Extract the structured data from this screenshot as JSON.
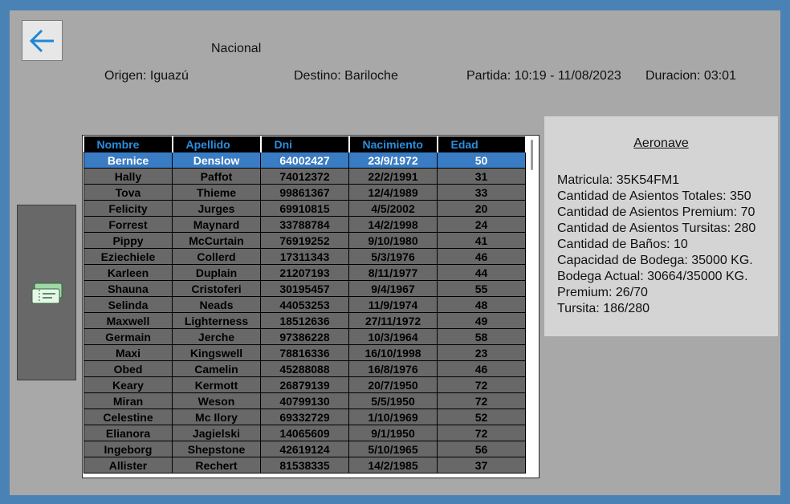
{
  "header": {
    "type": "Nacional",
    "origin": "Origen: Iguazú",
    "destination": "Destino: Bariloche",
    "departure": "Partida: 10:19 - 11/08/2023",
    "duration": "Duracion: 03:01"
  },
  "colors": {
    "accent": "#2a8ee0",
    "selected_row": "#3a7cc4",
    "row_bg": "#686868",
    "frame": "#4a82b5"
  },
  "icons": {
    "back": "arrow-left-icon",
    "tickets": "ticket-icon"
  },
  "table": {
    "columns": [
      "Nombre",
      "Apellido",
      "Dni",
      "Nacimiento",
      "Edad"
    ],
    "selected_index": 0,
    "rows": [
      [
        "Bernice",
        "Denslow",
        "64002427",
        "23/9/1972",
        "50"
      ],
      [
        "Hally",
        "Paffot",
        "74012372",
        "22/2/1991",
        "31"
      ],
      [
        "Tova",
        "Thieme",
        "99861367",
        "12/4/1989",
        "33"
      ],
      [
        "Felicity",
        "Jurges",
        "69910815",
        "4/5/2002",
        "20"
      ],
      [
        "Forrest",
        "Maynard",
        "33788784",
        "14/2/1998",
        "24"
      ],
      [
        "Pippy",
        "McCurtain",
        "76919252",
        "9/10/1980",
        "41"
      ],
      [
        "Eziechiele",
        "Collerd",
        "17311343",
        "5/3/1976",
        "46"
      ],
      [
        "Karleen",
        "Duplain",
        "21207193",
        "8/11/1977",
        "44"
      ],
      [
        "Shauna",
        "Cristoferi",
        "30195457",
        "9/4/1967",
        "55"
      ],
      [
        "Selinda",
        "Neads",
        "44053253",
        "11/9/1974",
        "48"
      ],
      [
        "Maxwell",
        "Lighterness",
        "18512636",
        "27/11/1972",
        "49"
      ],
      [
        "Germain",
        "Jerche",
        "97386228",
        "10/3/1964",
        "58"
      ],
      [
        "Maxi",
        "Kingswell",
        "78816336",
        "16/10/1998",
        "23"
      ],
      [
        "Obed",
        "Camelin",
        "45288088",
        "16/8/1976",
        "46"
      ],
      [
        "Keary",
        "Kermott",
        "26879139",
        "20/7/1950",
        "72"
      ],
      [
        "Miran",
        "Weson",
        "40799130",
        "5/5/1950",
        "72"
      ],
      [
        "Celestine",
        "Mc Ilory",
        "69332729",
        "1/10/1969",
        "52"
      ],
      [
        "Elianora",
        "Jagielski",
        "14065609",
        "9/1/1950",
        "72"
      ],
      [
        "Ingeborg",
        "Shepstone",
        "42619124",
        "5/10/1965",
        "56"
      ],
      [
        "Allister",
        "Rechert",
        "81538335",
        "14/2/1985",
        "37"
      ]
    ]
  },
  "aircraft": {
    "title": "Aeronave",
    "lines": [
      "Matricula: 35K54FM1",
      "Cantidad de Asientos Totales: 350",
      "Cantidad de Asientos Premium: 70",
      "Cantidad de Asientos Tursitas: 280",
      "Cantidad de Baños: 10",
      "Capacidad de Bodega: 35000 KG.",
      "Bodega Actual: 30664/35000 KG.",
      "Premium: 26/70",
      "Tursita: 186/280"
    ]
  }
}
